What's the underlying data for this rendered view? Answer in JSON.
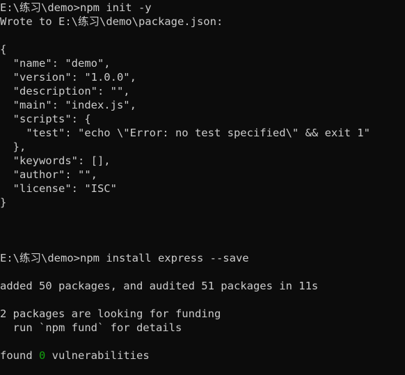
{
  "terminal": {
    "type": "windows-console",
    "colors": {
      "background": "#0c0c0c",
      "foreground": "#cccccc",
      "green": "#13a10e"
    },
    "prompt_path": "E:\\练习\\demo",
    "lines": [
      {
        "id": "l01",
        "text": "E:\\练习\\demo>npm init -y"
      },
      {
        "id": "l02",
        "text": "Wrote to E:\\练习\\demo\\package.json:"
      },
      {
        "id": "l03",
        "text": ""
      },
      {
        "id": "l04",
        "text": "{"
      },
      {
        "id": "l05",
        "text": "  \"name\": \"demo\","
      },
      {
        "id": "l06",
        "text": "  \"version\": \"1.0.0\","
      },
      {
        "id": "l07",
        "text": "  \"description\": \"\","
      },
      {
        "id": "l08",
        "text": "  \"main\": \"index.js\","
      },
      {
        "id": "l09",
        "text": "  \"scripts\": {"
      },
      {
        "id": "l10",
        "text": "    \"test\": \"echo \\\"Error: no test specified\\\" && exit 1\""
      },
      {
        "id": "l11",
        "text": "  },"
      },
      {
        "id": "l12",
        "text": "  \"keywords\": [],"
      },
      {
        "id": "l13",
        "text": "  \"author\": \"\","
      },
      {
        "id": "l14",
        "text": "  \"license\": \"ISC\""
      },
      {
        "id": "l15",
        "text": "}"
      },
      {
        "id": "l16",
        "text": ""
      },
      {
        "id": "l17",
        "text": ""
      },
      {
        "id": "l18",
        "text": ""
      },
      {
        "id": "l19",
        "text": "E:\\练习\\demo>npm install express --save"
      },
      {
        "id": "l20",
        "text": ""
      },
      {
        "id": "l21",
        "text": "added 50 packages, and audited 51 packages in 11s"
      },
      {
        "id": "l22",
        "text": ""
      },
      {
        "id": "l23",
        "text": "2 packages are looking for funding"
      },
      {
        "id": "l24",
        "text": "  run `npm fund` for details"
      },
      {
        "id": "l25",
        "text": ""
      },
      {
        "id": "l26a",
        "text": "found "
      },
      {
        "id": "l26b",
        "text": "0",
        "color": "green"
      },
      {
        "id": "l26c",
        "text": " vulnerabilities"
      }
    ],
    "commands": [
      "npm init -y",
      "npm install express --save"
    ],
    "package_json": {
      "name": "demo",
      "version": "1.0.0",
      "description": "",
      "main": "index.js",
      "scripts": {
        "test": "echo \"Error: no test specified\" && exit 1"
      },
      "keywords": [],
      "author": "",
      "license": "ISC"
    },
    "install_summary": {
      "added_packages": "50",
      "audited_packages": "51",
      "duration": "11s",
      "funding_packages": "2",
      "vulnerabilities": "0"
    }
  }
}
